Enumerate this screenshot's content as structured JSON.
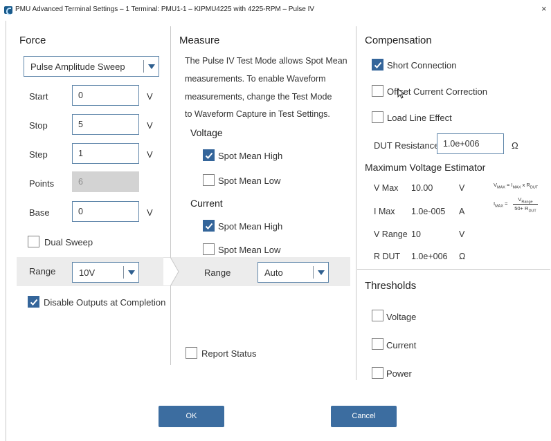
{
  "window": {
    "title": "PMU Advanced Terminal Settings – 1 Terminal: PMU1-1 – KIPMU4225 with 4225-RPM – Pulse IV",
    "close_glyph": "×"
  },
  "force": {
    "heading": "Force",
    "sweep_type": "Pulse Amplitude Sweep",
    "fields": [
      {
        "label": "Start",
        "value": "0",
        "unit": "V"
      },
      {
        "label": "Stop",
        "value": "5",
        "unit": "V"
      },
      {
        "label": "Step",
        "value": "1",
        "unit": "V"
      },
      {
        "label": "Points",
        "value": "6",
        "unit": ""
      },
      {
        "label": "Base",
        "value": "0",
        "unit": "V"
      }
    ],
    "dual_sweep": {
      "label": "Dual Sweep",
      "checked": false
    },
    "range": {
      "label": "Range",
      "value": "10V"
    },
    "disable_outputs": {
      "label": "Disable Outputs at Completion",
      "checked": true
    }
  },
  "measure": {
    "heading": "Measure",
    "info_lines": [
      "The Pulse IV Test Mode allows Spot Mean",
      "measurements. To enable Waveform",
      "measurements, change the Test Mode",
      "to Waveform Capture in Test Settings."
    ],
    "voltage": {
      "heading": "Voltage",
      "spot_mean_high": {
        "label": "Spot Mean High",
        "checked": true
      },
      "spot_mean_low": {
        "label": "Spot Mean Low",
        "checked": false
      }
    },
    "current": {
      "heading": "Current",
      "spot_mean_high": {
        "label": "Spot Mean High",
        "checked": true
      },
      "spot_mean_low": {
        "label": "Spot Mean Low",
        "checked": false
      }
    },
    "range": {
      "label": "Range",
      "value": "Auto"
    },
    "report_status": {
      "label": "Report Status",
      "checked": false
    }
  },
  "compensation": {
    "heading": "Compensation",
    "short_connection": {
      "label": "Short Connection",
      "checked": true
    },
    "offset_current": {
      "label": "Offset Current Correction",
      "checked": false
    },
    "load_line": {
      "label": "Load Line Effect",
      "checked": false
    },
    "dut_resistance": {
      "label": "DUT Resistance",
      "value": "1.0e+006",
      "unit": "Ω"
    }
  },
  "estimator": {
    "heading": "Maximum Voltage Estimator",
    "rows": [
      {
        "label": "V Max",
        "value": "10.00",
        "unit": "V"
      },
      {
        "label": "I Max",
        "value": "1.0e-005",
        "unit": "A"
      },
      {
        "label": "V Range",
        "value": "10",
        "unit": "V"
      },
      {
        "label": "R DUT",
        "value": "1.0e+006",
        "unit": "Ω"
      }
    ],
    "formula_vmax": {
      "lhs": "V",
      "lhs_sub": "MAX",
      "eq": " = I",
      "i_sub": "MAX",
      "x": " x R",
      "r_sub": "DUT"
    },
    "formula_imax": {
      "lhs": "I",
      "lhs_sub": "MAX",
      "eq": " = ",
      "num": "V",
      "num_sub": "Range",
      "den": "50+ R",
      "den_sub": "DUT"
    }
  },
  "thresholds": {
    "heading": "Thresholds",
    "items": [
      {
        "label": "Voltage",
        "checked": false
      },
      {
        "label": "Current",
        "checked": false
      },
      {
        "label": "Power",
        "checked": false
      }
    ]
  },
  "buttons": {
    "ok": "OK",
    "cancel": "Cancel"
  },
  "colors": {
    "accent": "#3c6da0",
    "checkbox_on": "#34659a",
    "border": "#5f86aa"
  }
}
